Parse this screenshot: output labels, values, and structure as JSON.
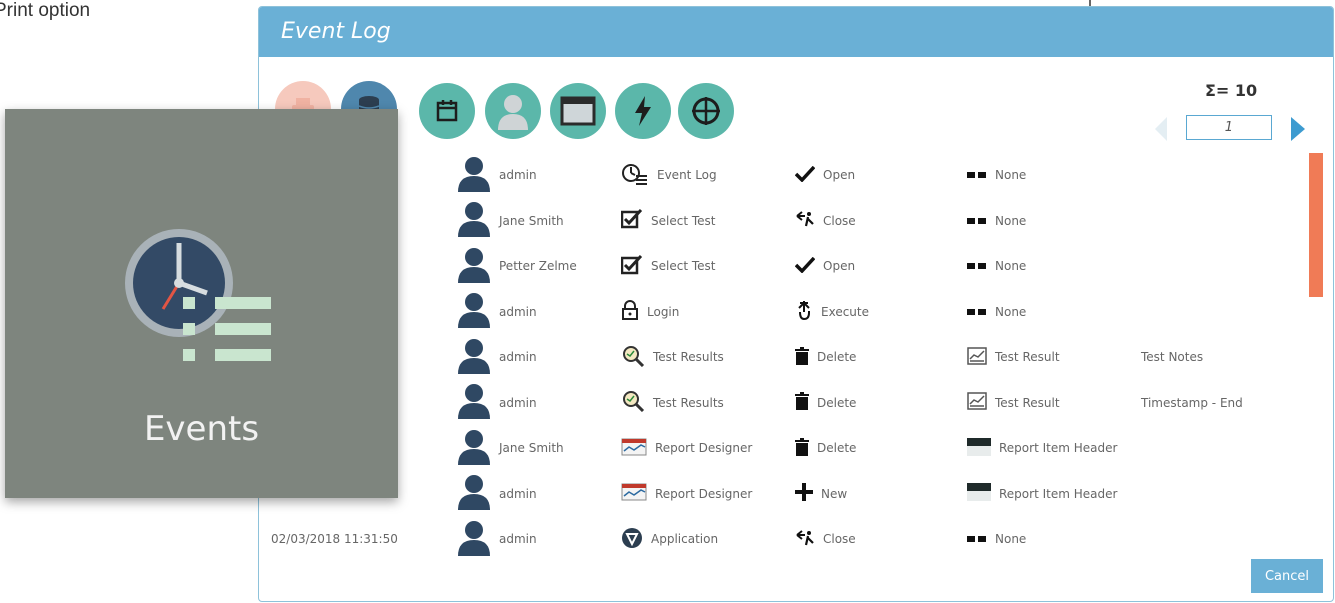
{
  "print_label": "Print option",
  "dialog": {
    "title": "Event Log",
    "count_label": "Σ= 10",
    "page_value": "1",
    "cancel_label": "Cancel"
  },
  "toolbar": {
    "buttons": [
      {
        "name": "print",
        "icon": "print-icon"
      },
      {
        "name": "database",
        "icon": "database-icon"
      },
      {
        "name": "date-filter",
        "icon": "calendar-icon"
      },
      {
        "name": "user-filter",
        "icon": "user-icon"
      },
      {
        "name": "module-filter",
        "icon": "window-icon"
      },
      {
        "name": "action-filter",
        "icon": "lightning-icon"
      },
      {
        "name": "target-filter",
        "icon": "target-icon"
      }
    ]
  },
  "rows": [
    {
      "date": "",
      "user": "admin",
      "module": "Event Log",
      "module_icon": "event-log-icon",
      "action": "Open",
      "action_icon": "checkmark-icon",
      "object": "None",
      "object_icon": "none-icon",
      "extra": ""
    },
    {
      "date": "",
      "user": "Jane Smith",
      "module": "Select Test",
      "module_icon": "checkbox-icon",
      "action": "Close",
      "action_icon": "close-action-icon",
      "object": "None",
      "object_icon": "none-icon",
      "extra": ""
    },
    {
      "date": "",
      "user": "Petter Zelme",
      "module": "Select Test",
      "module_icon": "checkbox-icon",
      "action": "Open",
      "action_icon": "checkmark-icon",
      "object": "None",
      "object_icon": "none-icon",
      "extra": ""
    },
    {
      "date": "",
      "user": "admin",
      "module": "Login",
      "module_icon": "lock-icon",
      "action": "Execute",
      "action_icon": "execute-icon",
      "object": "None",
      "object_icon": "none-icon",
      "extra": ""
    },
    {
      "date": "",
      "user": "admin",
      "module": "Test Results",
      "module_icon": "magnifier-icon",
      "action": "Delete",
      "action_icon": "trash-icon",
      "object": "Test Result",
      "object_icon": "chart-icon",
      "extra": "Test Notes"
    },
    {
      "date": "",
      "user": "admin",
      "module": "Test Results",
      "module_icon": "magnifier-icon",
      "action": "Delete",
      "action_icon": "trash-icon",
      "object": "Test Result",
      "object_icon": "chart-icon",
      "extra": "Timestamp - End"
    },
    {
      "date": "",
      "user": "Jane Smith",
      "module": "Report Designer",
      "module_icon": "report-icon",
      "action": "Delete",
      "action_icon": "trash-icon",
      "object": "Report Item Header",
      "object_icon": "header-icon",
      "extra": ""
    },
    {
      "date": "",
      "user": "admin",
      "module": "Report Designer",
      "module_icon": "report-icon",
      "action": "New",
      "action_icon": "plus-icon",
      "object": "Report Item Header",
      "object_icon": "header-icon",
      "extra": ""
    },
    {
      "date": "02/03/2018 11:31:50",
      "user": "admin",
      "module": "Application",
      "module_icon": "app-icon",
      "action": "Close",
      "action_icon": "close-action-icon",
      "object": "None",
      "object_icon": "none-icon",
      "extra": ""
    }
  ],
  "overlay": {
    "label": "Events",
    "icon": "events-clock-icon"
  },
  "colors": {
    "titlebar": "#6ab0d6",
    "tool_teal": "#5bb7aa",
    "scroll_thumb": "#f07b56",
    "overlay_bg": "#7e857e"
  }
}
